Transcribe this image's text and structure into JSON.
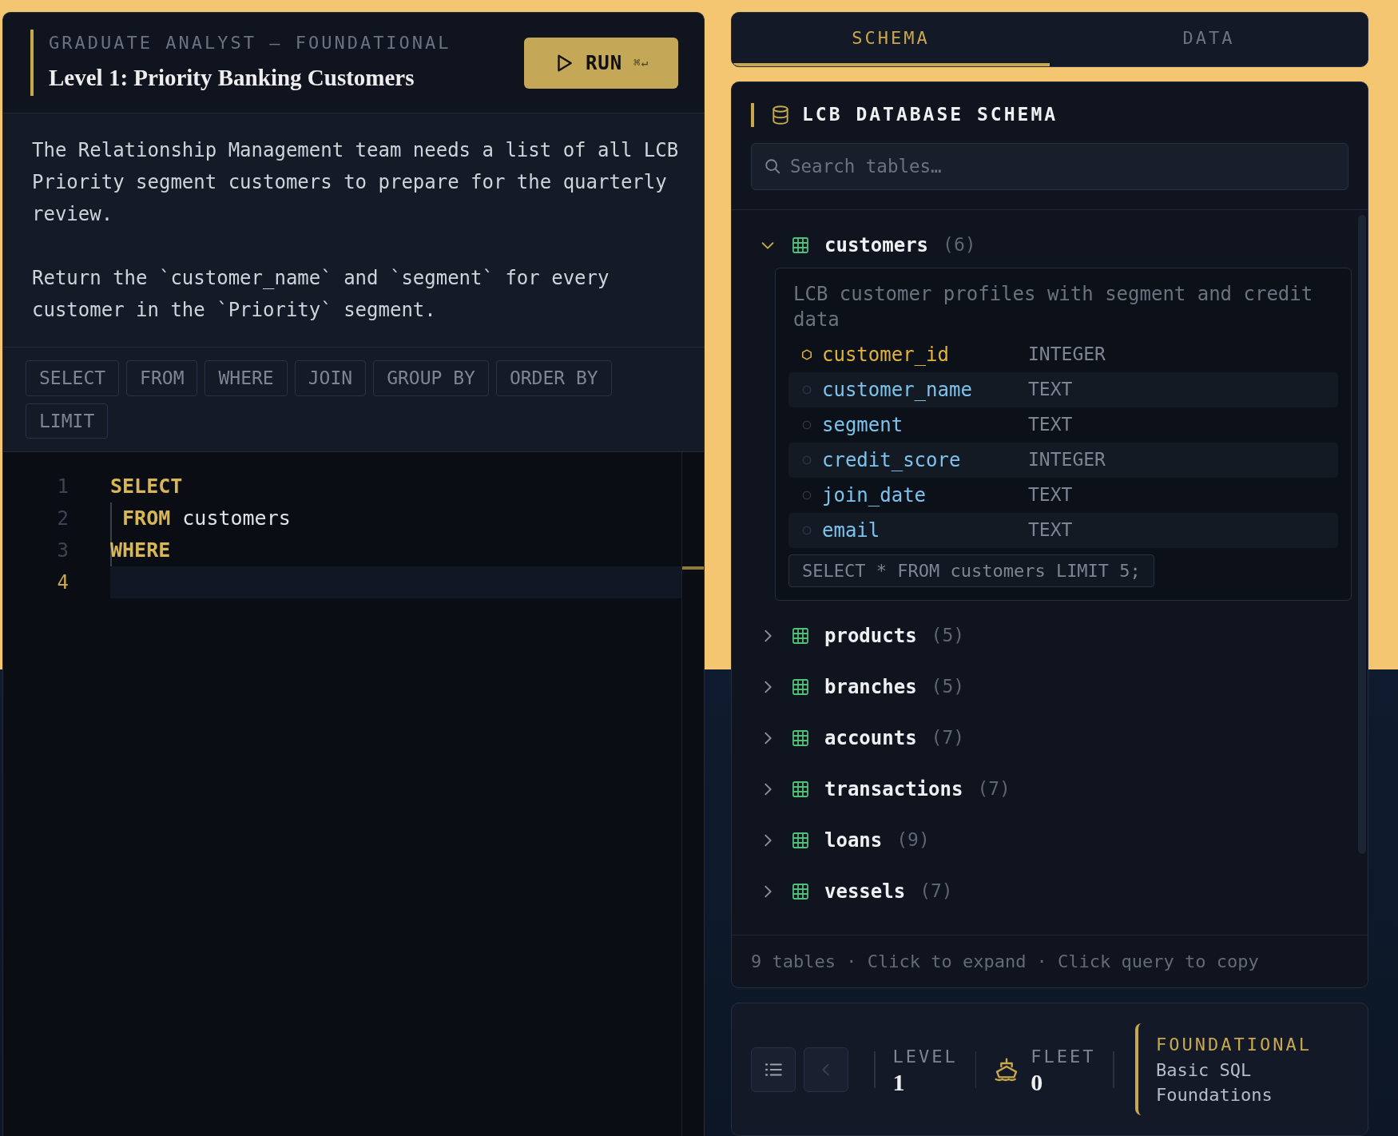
{
  "task": {
    "eyebrow": "GRADUATE ANALYST — FOUNDATIONAL",
    "title": "Level 1: Priority Banking Customers",
    "run_button": {
      "label": "RUN",
      "shortcut": "⌘↵"
    },
    "description": [
      "The Relationship Management team needs a list of all LCB Priority segment customers to prepare for the quarterly review.",
      "Return the `customer_name` and `segment` for every customer in the `Priority` segment."
    ]
  },
  "keywords": [
    "SELECT",
    "FROM",
    "WHERE",
    "JOIN",
    "GROUP BY",
    "ORDER BY",
    "LIMIT"
  ],
  "editor": {
    "lines": [
      {
        "number": "1",
        "current": false,
        "indent_guide": false,
        "tokens": [
          {
            "kind": "keyword",
            "text": "SELECT"
          }
        ]
      },
      {
        "number": "2",
        "current": false,
        "indent_guide": true,
        "tokens": [
          {
            "kind": "keyword",
            "text": " FROM"
          },
          {
            "kind": "plain",
            "text": " customers"
          }
        ]
      },
      {
        "number": "3",
        "current": false,
        "indent_guide": true,
        "tokens": [
          {
            "kind": "keyword",
            "text": "WHERE"
          }
        ]
      },
      {
        "number": "4",
        "current": true,
        "indent_guide": false
      }
    ]
  },
  "tabs": [
    {
      "label": "SCHEMA",
      "selected": true
    },
    {
      "label": "DATA",
      "selected": false
    }
  ],
  "schema": {
    "title": "LCB DATABASE SCHEMA",
    "search": {
      "placeholder": "Search tables…"
    },
    "tables": [
      {
        "name": "customers",
        "count": "(6)",
        "expanded": true,
        "description": "LCB customer profiles with segment and credit data",
        "columns": [
          {
            "name": "customer_id",
            "type": "INTEGER",
            "primary": true
          },
          {
            "name": "customer_name",
            "type": "TEXT",
            "primary": false
          },
          {
            "name": "segment",
            "type": "TEXT",
            "primary": false
          },
          {
            "name": "credit_score",
            "type": "INTEGER",
            "primary": false
          },
          {
            "name": "join_date",
            "type": "TEXT",
            "primary": false
          },
          {
            "name": "email",
            "type": "TEXT",
            "primary": false
          }
        ],
        "sample_query": "SELECT * FROM customers LIMIT 5;"
      },
      {
        "name": "products",
        "count": "(5)",
        "expanded": false
      },
      {
        "name": "branches",
        "count": "(5)",
        "expanded": false
      },
      {
        "name": "accounts",
        "count": "(7)",
        "expanded": false
      },
      {
        "name": "transactions",
        "count": "(7)",
        "expanded": false
      },
      {
        "name": "loans",
        "count": "(9)",
        "expanded": false
      },
      {
        "name": "vessels",
        "count": "(7)",
        "expanded": false
      }
    ],
    "footer": "9 tables · Click to expand · Click query to copy"
  },
  "status": {
    "buttons": [
      {
        "kind": "list",
        "disabled": false
      },
      {
        "kind": "back",
        "disabled": true
      }
    ],
    "level": {
      "label": "LEVEL",
      "value": "1"
    },
    "fleet": {
      "label": "FLEET",
      "value": "0"
    },
    "tier": {
      "name": "FOUNDATIONAL",
      "subtitle": "Basic SQL Foundations"
    }
  }
}
